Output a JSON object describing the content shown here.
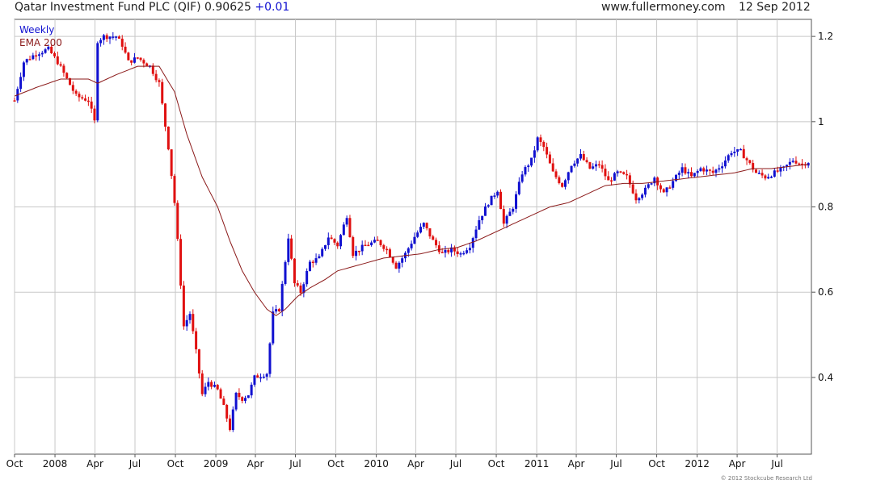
{
  "header": {
    "security": "Qatar Investment Fund PLC (QIF)",
    "price": "0.90625",
    "change": "+0.01",
    "website": "www.fullermoney.com",
    "date": "12 Sep 2012"
  },
  "footer": {
    "copyright": "© 2012 Stockcube Research Ltd"
  },
  "colors": {
    "up": "#1010d0",
    "down": "#e01010",
    "ema": "#8b1a1a",
    "grid": "#c8c8c8",
    "change": "#1010d0"
  },
  "chart_data": {
    "type": "candlestick",
    "interval_label": "Weekly",
    "x_start": "2007-10-01",
    "x_end": "2012-09-17",
    "ylim": [
      0.22,
      1.24
    ],
    "y_ticks": [
      0.4,
      0.6,
      0.8,
      1,
      1.2
    ],
    "y_tick_labels": [
      "0.4",
      "0.6",
      "0.8",
      "1",
      "1.2"
    ],
    "x_ticks": [
      {
        "label": "Oct",
        "date": "2007-10-01"
      },
      {
        "label": "2008",
        "date": "2008-01-01"
      },
      {
        "label": "Apr",
        "date": "2008-04-01"
      },
      {
        "label": "Jul",
        "date": "2008-07-01"
      },
      {
        "label": "Oct",
        "date": "2008-10-01"
      },
      {
        "label": "2009",
        "date": "2009-01-01"
      },
      {
        "label": "Apr",
        "date": "2009-04-01"
      },
      {
        "label": "Jul",
        "date": "2009-07-01"
      },
      {
        "label": "Oct",
        "date": "2009-10-01"
      },
      {
        "label": "2010",
        "date": "2010-01-01"
      },
      {
        "label": "Apr",
        "date": "2010-04-01"
      },
      {
        "label": "Jul",
        "date": "2010-07-01"
      },
      {
        "label": "Oct",
        "date": "2010-10-01"
      },
      {
        "label": "2011",
        "date": "2011-01-01"
      },
      {
        "label": "Apr",
        "date": "2011-04-01"
      },
      {
        "label": "Jul",
        "date": "2011-07-01"
      },
      {
        "label": "Oct",
        "date": "2011-10-01"
      },
      {
        "label": "2012",
        "date": "2012-01-01"
      },
      {
        "label": "Apr",
        "date": "2012-04-01"
      },
      {
        "label": "Jul",
        "date": "2012-07-01"
      }
    ],
    "grid": true,
    "series": [
      {
        "name": "Weekly",
        "type": "candlestick",
        "ohlc_date_close_keyframes": [
          [
            "2007-10-01",
            1.05
          ],
          [
            "2007-10-22",
            1.14
          ],
          [
            "2007-11-19",
            1.16
          ],
          [
            "2007-12-17",
            1.17
          ],
          [
            "2008-01-07",
            1.14
          ],
          [
            "2008-01-28",
            1.1
          ],
          [
            "2008-02-18",
            1.06
          ],
          [
            "2008-03-17",
            1.05
          ],
          [
            "2008-03-31",
            1.0
          ],
          [
            "2008-04-07",
            1.19
          ],
          [
            "2008-04-21",
            1.2
          ],
          [
            "2008-05-19",
            1.2
          ],
          [
            "2008-06-02",
            1.18
          ],
          [
            "2008-06-16",
            1.14
          ],
          [
            "2008-07-07",
            1.15
          ],
          [
            "2008-08-04",
            1.13
          ],
          [
            "2008-08-25",
            1.09
          ],
          [
            "2008-09-15",
            0.94
          ],
          [
            "2008-09-29",
            0.81
          ],
          [
            "2008-10-06",
            0.72
          ],
          [
            "2008-10-20",
            0.52
          ],
          [
            "2008-11-03",
            0.55
          ],
          [
            "2008-11-17",
            0.46
          ],
          [
            "2008-12-01",
            0.36
          ],
          [
            "2008-12-15",
            0.39
          ],
          [
            "2009-01-05",
            0.37
          ],
          [
            "2009-01-19",
            0.33
          ],
          [
            "2009-02-02",
            0.28
          ],
          [
            "2009-02-16",
            0.36
          ],
          [
            "2009-03-02",
            0.35
          ],
          [
            "2009-03-16",
            0.36
          ],
          [
            "2009-03-30",
            0.4
          ],
          [
            "2009-04-27",
            0.41
          ],
          [
            "2009-05-11",
            0.55
          ],
          [
            "2009-05-25",
            0.56
          ],
          [
            "2009-06-15",
            0.73
          ],
          [
            "2009-06-29",
            0.62
          ],
          [
            "2009-07-13",
            0.6
          ],
          [
            "2009-08-03",
            0.67
          ],
          [
            "2009-08-24",
            0.68
          ],
          [
            "2009-09-14",
            0.73
          ],
          [
            "2009-10-05",
            0.71
          ],
          [
            "2009-10-26",
            0.78
          ],
          [
            "2009-11-09",
            0.69
          ],
          [
            "2009-12-07",
            0.71
          ],
          [
            "2010-01-04",
            0.72
          ],
          [
            "2010-01-25",
            0.7
          ],
          [
            "2010-02-15",
            0.66
          ],
          [
            "2010-03-08",
            0.69
          ],
          [
            "2010-03-29",
            0.73
          ],
          [
            "2010-04-19",
            0.76
          ],
          [
            "2010-05-10",
            0.72
          ],
          [
            "2010-05-31",
            0.69
          ],
          [
            "2010-06-21",
            0.7
          ],
          [
            "2010-07-12",
            0.69
          ],
          [
            "2010-08-02",
            0.71
          ],
          [
            "2010-08-23",
            0.77
          ],
          [
            "2010-09-13",
            0.81
          ],
          [
            "2010-10-04",
            0.84
          ],
          [
            "2010-10-18",
            0.76
          ],
          [
            "2010-11-08",
            0.8
          ],
          [
            "2010-11-29",
            0.88
          ],
          [
            "2010-12-20",
            0.91
          ],
          [
            "2011-01-03",
            0.96
          ],
          [
            "2011-01-17",
            0.94
          ],
          [
            "2011-02-07",
            0.88
          ],
          [
            "2011-02-28",
            0.85
          ],
          [
            "2011-03-21",
            0.9
          ],
          [
            "2011-04-11",
            0.92
          ],
          [
            "2011-05-02",
            0.89
          ],
          [
            "2011-05-23",
            0.9
          ],
          [
            "2011-06-13",
            0.86
          ],
          [
            "2011-07-04",
            0.88
          ],
          [
            "2011-07-25",
            0.87
          ],
          [
            "2011-08-15",
            0.82
          ],
          [
            "2011-09-05",
            0.84
          ],
          [
            "2011-09-26",
            0.87
          ],
          [
            "2011-10-17",
            0.83
          ],
          [
            "2011-11-07",
            0.86
          ],
          [
            "2011-11-28",
            0.89
          ],
          [
            "2011-12-19",
            0.87
          ],
          [
            "2012-01-09",
            0.89
          ],
          [
            "2012-02-06",
            0.88
          ],
          [
            "2012-02-27",
            0.9
          ],
          [
            "2012-03-19",
            0.93
          ],
          [
            "2012-04-09",
            0.93
          ],
          [
            "2012-04-30",
            0.9
          ],
          [
            "2012-05-14",
            0.88
          ],
          [
            "2012-06-04",
            0.87
          ],
          [
            "2012-06-25",
            0.88
          ],
          [
            "2012-07-16",
            0.89
          ],
          [
            "2012-08-06",
            0.91
          ],
          [
            "2012-08-27",
            0.9
          ],
          [
            "2012-09-10",
            0.906
          ]
        ]
      },
      {
        "name": "EMA 200",
        "type": "line",
        "keyframes": [
          [
            "2007-10-01",
            1.06
          ],
          [
            "2007-11-19",
            1.08
          ],
          [
            "2008-01-14",
            1.1
          ],
          [
            "2008-03-17",
            1.1
          ],
          [
            "2008-04-07",
            1.09
          ],
          [
            "2008-05-19",
            1.11
          ],
          [
            "2008-07-07",
            1.13
          ],
          [
            "2008-08-25",
            1.13
          ],
          [
            "2008-09-29",
            1.07
          ],
          [
            "2008-10-27",
            0.97
          ],
          [
            "2008-12-01",
            0.87
          ],
          [
            "2009-01-05",
            0.8
          ],
          [
            "2009-02-02",
            0.72
          ],
          [
            "2009-03-02",
            0.65
          ],
          [
            "2009-03-30",
            0.6
          ],
          [
            "2009-04-27",
            0.56
          ],
          [
            "2009-05-18",
            0.545
          ],
          [
            "2009-06-08",
            0.56
          ],
          [
            "2009-07-06",
            0.59
          ],
          [
            "2009-08-03",
            0.61
          ],
          [
            "2009-09-07",
            0.63
          ],
          [
            "2009-10-05",
            0.65
          ],
          [
            "2009-11-09",
            0.66
          ],
          [
            "2009-12-14",
            0.67
          ],
          [
            "2010-01-18",
            0.68
          ],
          [
            "2010-03-01",
            0.685
          ],
          [
            "2010-04-12",
            0.69
          ],
          [
            "2010-05-24",
            0.7
          ],
          [
            "2010-07-05",
            0.705
          ],
          [
            "2010-08-16",
            0.72
          ],
          [
            "2010-09-27",
            0.74
          ],
          [
            "2010-11-08",
            0.76
          ],
          [
            "2010-12-20",
            0.78
          ],
          [
            "2011-01-31",
            0.8
          ],
          [
            "2011-03-14",
            0.81
          ],
          [
            "2011-04-25",
            0.83
          ],
          [
            "2011-06-06",
            0.85
          ],
          [
            "2011-07-18",
            0.855
          ],
          [
            "2011-08-29",
            0.855
          ],
          [
            "2011-10-10",
            0.86
          ],
          [
            "2011-11-21",
            0.865
          ],
          [
            "2012-01-02",
            0.87
          ],
          [
            "2012-02-13",
            0.875
          ],
          [
            "2012-03-26",
            0.88
          ],
          [
            "2012-05-07",
            0.89
          ],
          [
            "2012-06-18",
            0.89
          ],
          [
            "2012-07-30",
            0.895
          ],
          [
            "2012-09-10",
            0.9
          ]
        ]
      }
    ]
  }
}
